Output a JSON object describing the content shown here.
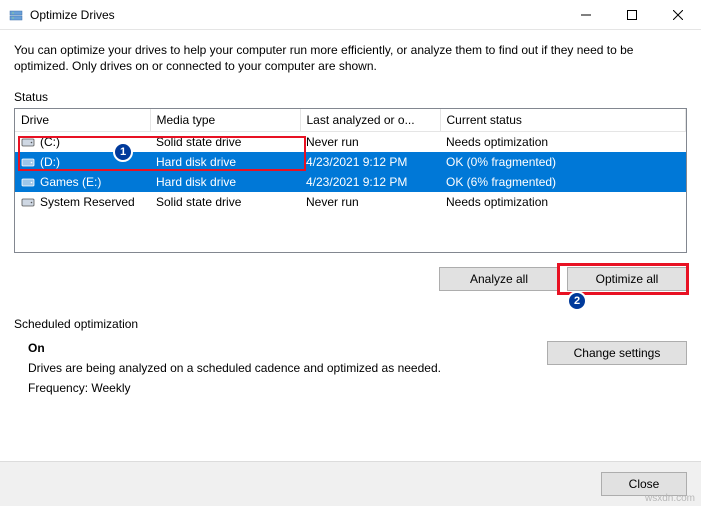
{
  "window": {
    "title": "Optimize Drives"
  },
  "intro": "You can optimize your drives to help your computer run more efficiently, or analyze them to find out if they need to be optimized. Only drives on or connected to your computer are shown.",
  "status_label": "Status",
  "columns": {
    "drive": "Drive",
    "media": "Media type",
    "last": "Last analyzed or o...",
    "status": "Current status"
  },
  "drives": [
    {
      "name": "(C:)",
      "media": "Solid state drive",
      "last": "Never run",
      "status": "Needs optimization",
      "selected": false,
      "icon": "ssd"
    },
    {
      "name": "(D:)",
      "media": "Hard disk drive",
      "last": "4/23/2021 9:12 PM",
      "status": "OK (0% fragmented)",
      "selected": true,
      "icon": "hdd"
    },
    {
      "name": "Games (E:)",
      "media": "Hard disk drive",
      "last": "4/23/2021 9:12 PM",
      "status": "OK (6% fragmented)",
      "selected": true,
      "icon": "hdd"
    },
    {
      "name": "System Reserved",
      "media": "Solid state drive",
      "last": "Never run",
      "status": "Needs optimization",
      "selected": false,
      "icon": "ssd"
    }
  ],
  "buttons": {
    "analyze_all": "Analyze all",
    "optimize_all": "Optimize all",
    "change_settings": "Change settings",
    "close": "Close"
  },
  "scheduled": {
    "label": "Scheduled optimization",
    "on": "On",
    "desc": "Drives are being analyzed on a scheduled cadence and optimized as needed.",
    "frequency_label": "Frequency: ",
    "frequency_value": "Weekly"
  },
  "annotations": {
    "badge1": "1",
    "badge2": "2"
  },
  "watermark": "wsxdn.com"
}
